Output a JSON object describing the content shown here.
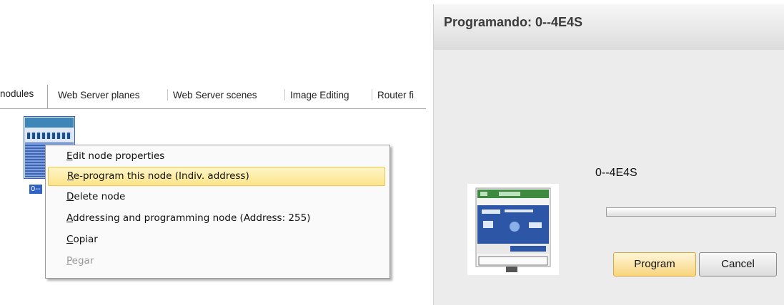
{
  "tabs": [
    {
      "label": "nodules",
      "active": true
    },
    {
      "label": "Web Server planes"
    },
    {
      "label": "Web Server scenes"
    },
    {
      "label": "Image Editing"
    },
    {
      "label": "Router fi"
    }
  ],
  "node": {
    "label": "0--"
  },
  "context_menu": {
    "items": [
      {
        "mnemonic": "E",
        "rest": "dit node properties",
        "state": "normal"
      },
      {
        "mnemonic": "R",
        "rest": "e-program this node (Indiv. address)",
        "state": "highlighted"
      },
      {
        "mnemonic": "D",
        "rest": "elete node",
        "state": "normal"
      },
      {
        "mnemonic": "A",
        "rest": "ddressing and programming node (Address: 255)",
        "state": "normal"
      },
      {
        "mnemonic": "C",
        "rest": "opiar",
        "state": "normal"
      },
      {
        "mnemonic": "P",
        "rest": "egar",
        "state": "disabled"
      }
    ]
  },
  "dialog": {
    "title": "Programando: 0--4E4S",
    "device_name": "0--4E4S",
    "progress": 0.0,
    "buttons": {
      "program": "Program",
      "cancel": "Cancel"
    }
  },
  "colors": {
    "highlight": "#fce48a",
    "selection": "#2f63c6"
  }
}
